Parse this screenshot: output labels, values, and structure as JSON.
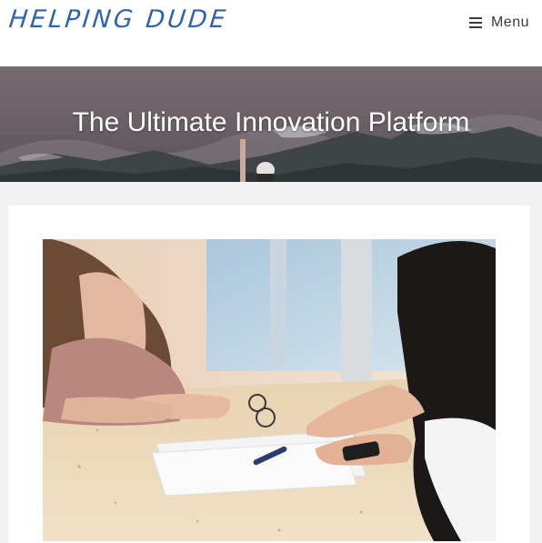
{
  "header": {
    "logo_text": "HELPING DUDE",
    "menu_label": "Menu",
    "menu_icon": "hamburger-icon"
  },
  "banner": {
    "title": "The Ultimate Innovation Platform"
  },
  "colors": {
    "logo": "#2f63b1",
    "header_bg": "#ffffff",
    "page_bg": "#f1f1f1",
    "banner_overlay": "#5f575d",
    "title_text": "#ffffff"
  },
  "featured_image": {
    "subject": "two-women-meeting-photo"
  }
}
